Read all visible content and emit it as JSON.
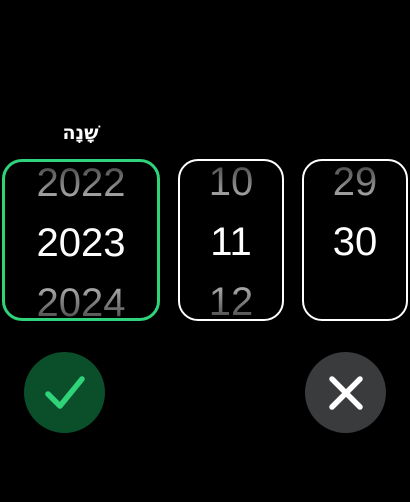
{
  "picker": {
    "label": "שָׁנָה",
    "year": {
      "prev": "2022",
      "current": "2023",
      "next": "2024"
    },
    "month": {
      "prev": "10",
      "current": "11",
      "next": "12"
    },
    "day": {
      "prev": "29",
      "current": "30"
    }
  },
  "actions": {
    "confirm_icon": "checkmark-icon",
    "cancel_icon": "close-icon"
  },
  "colors": {
    "background": "#000000",
    "accent": "#2fd37a",
    "confirm_bg": "#0a4f2a",
    "cancel_bg": "#3a3b3d"
  }
}
